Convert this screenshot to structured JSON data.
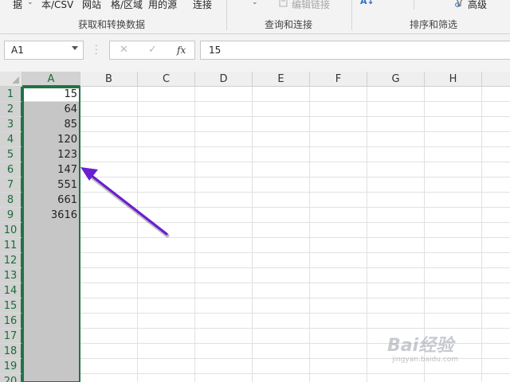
{
  "ribbon": {
    "items": [
      "据",
      "本/CSV",
      "网站",
      "格/区域",
      "用的源",
      "连接",
      "编辑链接",
      "A↓",
      "高级"
    ],
    "groups": [
      "获取和转换数据",
      "查询和连接",
      "排序和筛选"
    ]
  },
  "formula_bar": {
    "name_box": "A1",
    "cancel_icon": "✕",
    "enter_icon": "✓",
    "fx_label": "fx",
    "value": "15"
  },
  "columns": [
    "A",
    "B",
    "C",
    "D",
    "E",
    "F",
    "G",
    "H"
  ],
  "rows": [
    "1",
    "2",
    "3",
    "4",
    "5",
    "6",
    "7",
    "8",
    "9",
    "10",
    "11",
    "12",
    "13",
    "14",
    "15",
    "16",
    "17",
    "18",
    "19",
    "20"
  ],
  "column_a_values": [
    "15",
    "64",
    "85",
    "120",
    "123",
    "147",
    "551",
    "661",
    "3616"
  ],
  "selection": {
    "range": "A:A",
    "active_cell": "A1"
  },
  "annotation": {
    "type": "arrow",
    "color": "#6a1fd0",
    "points_to": "A6"
  },
  "watermark": {
    "line1": "Bai经验",
    "line2": "jingyan.baidu.com"
  }
}
